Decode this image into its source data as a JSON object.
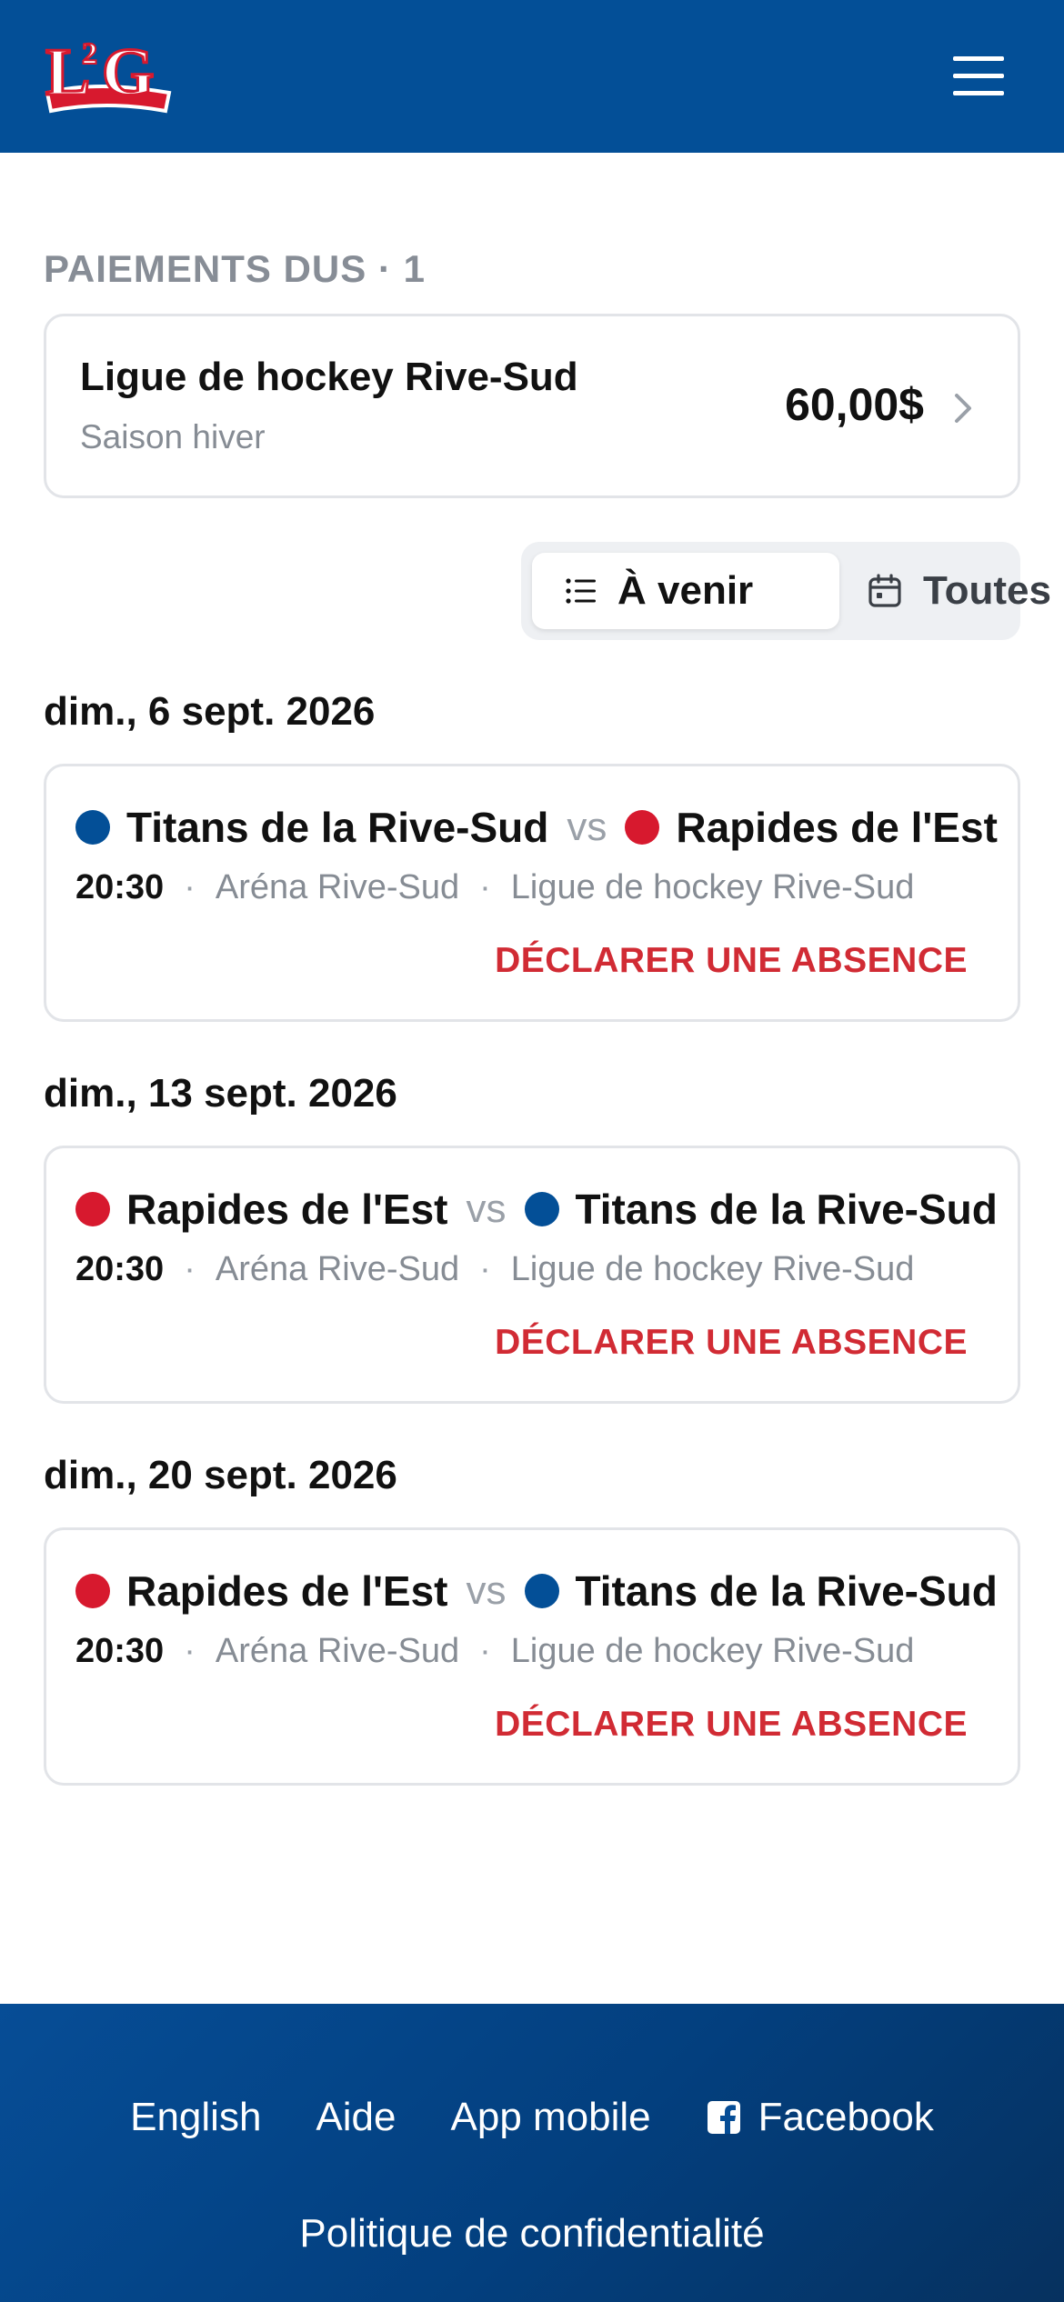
{
  "header": {
    "logo_text": "L2G",
    "menu_icon": "hamburger-icon"
  },
  "payments": {
    "section_label": "PAIEMENTS DUS · 1",
    "items": [
      {
        "title": "Ligue de hockey Rive-Sud",
        "subtitle": "Saison hiver",
        "amount": "60,00$"
      }
    ]
  },
  "filter": {
    "upcoming_label": "À venir",
    "upcoming_icon": "list-icon",
    "all_label": "Toutes",
    "all_icon": "calendar-icon",
    "active": "upcoming"
  },
  "colors": {
    "brand_blue": "#034f97",
    "team_blue": "#034f97",
    "team_red": "#d7192e",
    "absence_red": "#d12b34"
  },
  "games": [
    {
      "date": "dim., 6 sept. 2026",
      "home_team": "Titans de la Rive-Sud",
      "home_color": "#034f97",
      "vs": "vs",
      "away_team": "Rapides de l'Est",
      "away_color": "#d7192e",
      "time": "20:30",
      "arena": "Aréna Rive-Sud",
      "league": "Ligue de hockey Rive-Sud",
      "action": "DÉCLARER UNE ABSENCE"
    },
    {
      "date": "dim., 13 sept. 2026",
      "home_team": "Rapides de l'Est",
      "home_color": "#d7192e",
      "vs": "vs",
      "away_team": "Titans de la Rive-Sud",
      "away_color": "#034f97",
      "time": "20:30",
      "arena": "Aréna Rive-Sud",
      "league": "Ligue de hockey Rive-Sud",
      "action": "DÉCLARER UNE ABSENCE"
    },
    {
      "date": "dim., 20 sept. 2026",
      "home_team": "Rapides de l'Est",
      "home_color": "#d7192e",
      "vs": "vs",
      "away_team": "Titans de la Rive-Sud",
      "away_color": "#034f97",
      "time": "20:30",
      "arena": "Aréna Rive-Sud",
      "league": "Ligue de hockey Rive-Sud",
      "action": "DÉCLARER UNE ABSENCE"
    }
  ],
  "footer": {
    "links": [
      "English",
      "Aide",
      "App mobile",
      "Facebook"
    ],
    "facebook_icon": "facebook-icon",
    "privacy": "Politique de confidentialité"
  }
}
